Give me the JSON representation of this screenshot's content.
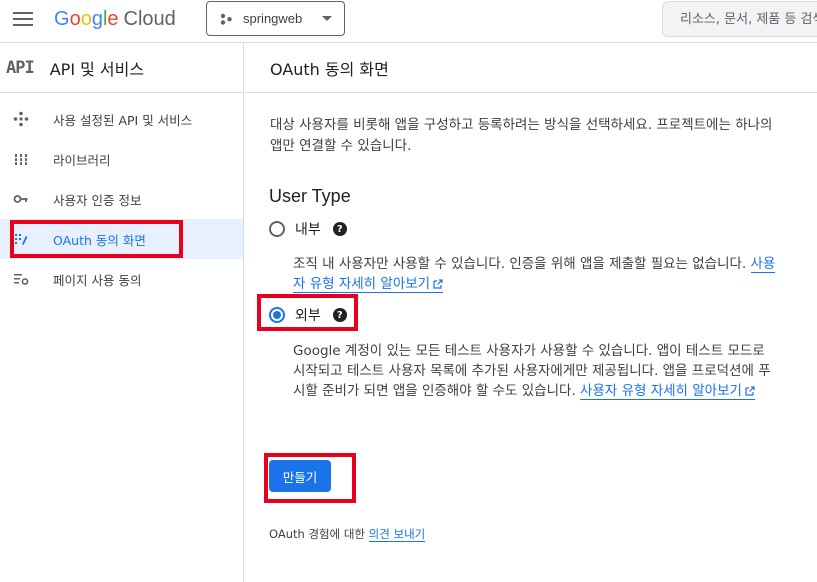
{
  "topbar": {
    "logo_letters": [
      "G",
      "o",
      "o",
      "g",
      "l",
      "e"
    ],
    "logo_suffix": "Cloud",
    "project_name": "springweb",
    "search_placeholder": "리소스, 문서, 제품 등 검색"
  },
  "sidebar": {
    "api_badge": "API",
    "title": "API 및 서비스",
    "items": [
      {
        "label": "사용 설정된 API 및 서비스",
        "icon": "diamond-arrows-icon"
      },
      {
        "label": "라이브러리",
        "icon": "library-grid-icon"
      },
      {
        "label": "사용자 인증 정보",
        "icon": "key-icon"
      },
      {
        "label": "OAuth 동의 화면",
        "icon": "oauth-consent-icon",
        "active": true
      },
      {
        "label": "페이지 사용 동의",
        "icon": "settings-list-icon"
      }
    ]
  },
  "main": {
    "title": "OAuth 동의 화면",
    "intro": "대상 사용자를 비롯해 앱을 구성하고 등록하려는 방식을 선택하세요. 프로젝트에는 하나의 앱만 연결할 수 있습니다.",
    "user_type_title": "User Type",
    "options": [
      {
        "label": "내부",
        "selected": false,
        "description": "조직 내 사용자만 사용할 수 있습니다. 인증을 위해 앱을 제출할 필요는 없습니다.",
        "link": "사용자 유형 자세히 알아보기"
      },
      {
        "label": "외부",
        "selected": true,
        "description": "Google 계정이 있는 모든 테스트 사용자가 사용할 수 있습니다. 앱이 테스트 모드로 시작되고 테스트 사용자 목록에 추가된 사용자에게만 제공됩니다. 앱을 프로덕션에 푸시할 준비가 되면 앱을 인증해야 할 수도 있습니다.",
        "link": "사용자 유형 자세히 알아보기"
      }
    ],
    "create_label": "만들기",
    "feedback_prefix": "OAuth 경험에 대한",
    "feedback_link": "의견 보내기"
  },
  "colors": {
    "accent": "#1a73e8",
    "annotation_red": "#e8001c",
    "active_nav_bg": "#e8f0fe"
  }
}
